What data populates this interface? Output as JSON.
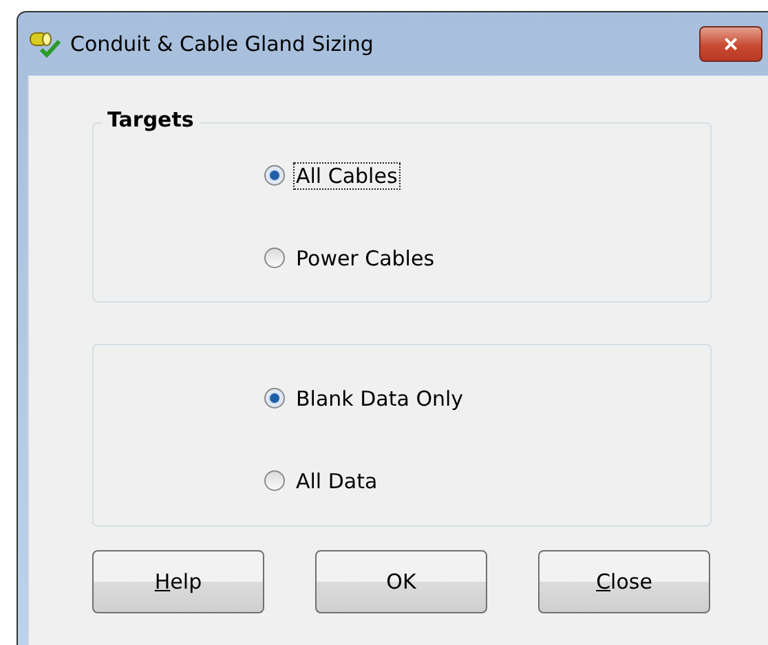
{
  "window": {
    "title": "Conduit & Cable Gland Sizing",
    "close_label": "×"
  },
  "groups": [
    {
      "title": "Targets",
      "options": [
        {
          "label": "All Cables",
          "selected": true,
          "focused": true
        },
        {
          "label": "Power Cables",
          "selected": false,
          "focused": false
        }
      ]
    },
    {
      "options": [
        {
          "label": "Blank Data Only",
          "selected": true,
          "focused": false
        },
        {
          "label": "All Data",
          "selected": false,
          "focused": false
        }
      ]
    }
  ],
  "buttons": [
    {
      "mnemonic": "H",
      "rest": "elp"
    },
    {
      "rest": "OK"
    },
    {
      "mnemonic": "C",
      "rest": "lose"
    }
  ]
}
